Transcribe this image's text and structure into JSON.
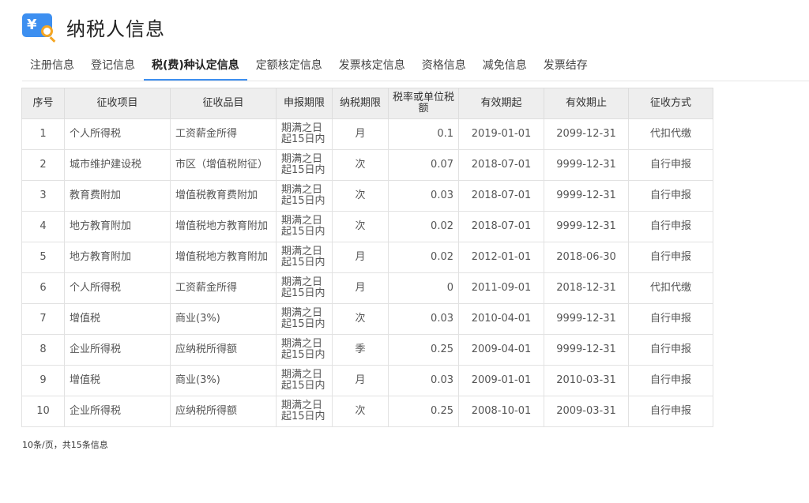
{
  "header": {
    "title": "纳税人信息",
    "logo_icon": "tax-search-icon",
    "logo_glyph": "¥"
  },
  "tabs": [
    "注册信息",
    "登记信息",
    "税(费)种认定信息",
    "定额核定信息",
    "发票核定信息",
    "资格信息",
    "减免信息",
    "发票结存"
  ],
  "active_tab_index": 2,
  "colors": {
    "accent": "#3d8ff0",
    "header_bg": "#eeeeee",
    "magnifier": "#f5a623"
  },
  "table": {
    "columns": [
      "序号",
      "征收项目",
      "征收品目",
      "申报期限",
      "纳税期限",
      "税率或单位税额",
      "有效期起",
      "有效期止",
      "征收方式"
    ],
    "rows": [
      [
        "1",
        "个人所得税",
        "工资薪金所得",
        "期满之日起15日内",
        "月",
        "0.1",
        "2019-01-01",
        "2099-12-31",
        "代扣代缴"
      ],
      [
        "2",
        "城市维护建设税",
        "市区（增值税附征）",
        "期满之日起15日内",
        "次",
        "0.07",
        "2018-07-01",
        "9999-12-31",
        "自行申报"
      ],
      [
        "3",
        "教育费附加",
        "增值税教育费附加",
        "期满之日起15日内",
        "次",
        "0.03",
        "2018-07-01",
        "9999-12-31",
        "自行申报"
      ],
      [
        "4",
        "地方教育附加",
        "增值税地方教育附加",
        "期满之日起15日内",
        "次",
        "0.02",
        "2018-07-01",
        "9999-12-31",
        "自行申报"
      ],
      [
        "5",
        "地方教育附加",
        "增值税地方教育附加",
        "期满之日起15日内",
        "月",
        "0.02",
        "2012-01-01",
        "2018-06-30",
        "自行申报"
      ],
      [
        "6",
        "个人所得税",
        "工资薪金所得",
        "期满之日起15日内",
        "月",
        "0",
        "2011-09-01",
        "2018-12-31",
        "代扣代缴"
      ],
      [
        "7",
        "增值税",
        "商业(3%)",
        "期满之日起15日内",
        "次",
        "0.03",
        "2010-04-01",
        "9999-12-31",
        "自行申报"
      ],
      [
        "8",
        "企业所得税",
        "应纳税所得额",
        "期满之日起15日内",
        "季",
        "0.25",
        "2009-04-01",
        "9999-12-31",
        "自行申报"
      ],
      [
        "9",
        "增值税",
        "商业(3%)",
        "期满之日起15日内",
        "月",
        "0.03",
        "2009-01-01",
        "2010-03-31",
        "自行申报"
      ],
      [
        "10",
        "企业所得税",
        "应纳税所得额",
        "期满之日起15日内",
        "次",
        "0.25",
        "2008-10-01",
        "2009-03-31",
        "自行申报"
      ]
    ]
  },
  "pagination": {
    "summary": "10条/页，共15条信息"
  }
}
